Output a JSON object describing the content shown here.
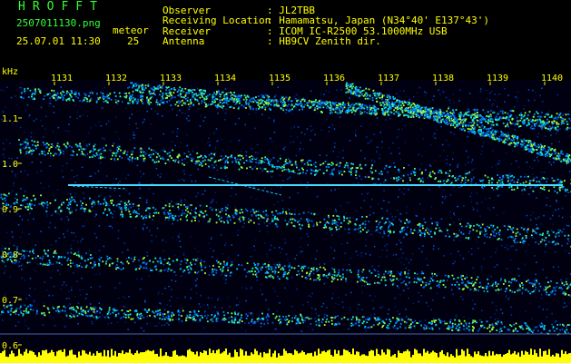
{
  "header": {
    "logo": "HROFFT",
    "filename": "2507011130.png",
    "datetime": "25.07.01 11:30",
    "meteor_label": "meteor",
    "meteor_count": "25",
    "fields": [
      {
        "label": "Observer",
        "value": ": JL2TBB"
      },
      {
        "label": "Receiving Location",
        "value": ": Hamamatsu, Japan (N34°40' E137°43')"
      },
      {
        "label": "Receiver",
        "value": ": ICOM IC-R2500 53.1000MHz USB"
      },
      {
        "label": "Antenna",
        "value": ": HB9CV Zenith dir."
      }
    ]
  },
  "colors": {
    "background": "#000000",
    "header_green": "#33ff33",
    "header_yellow": "#ffff00",
    "header_cyan": "#00ffff",
    "signal_carrier": "#44ddff",
    "bottom_noise": "#ffff00"
  },
  "chart_data": {
    "type": "heatmap",
    "ylabel": "kHz",
    "x_ticks": [
      "1131",
      "1132",
      "1133",
      "1134",
      "1135",
      "1136",
      "1137",
      "1138",
      "1139",
      "1140"
    ],
    "y_ticks": [
      "1.1",
      "1.0",
      "0.9",
      "0.8",
      "0.7",
      "0.6"
    ],
    "ylim": [
      0.6,
      1.2
    ],
    "carrier_khz": 0.955,
    "colormap": [
      "dark blue",
      "blue",
      "cyan",
      "green",
      "yellow"
    ]
  }
}
